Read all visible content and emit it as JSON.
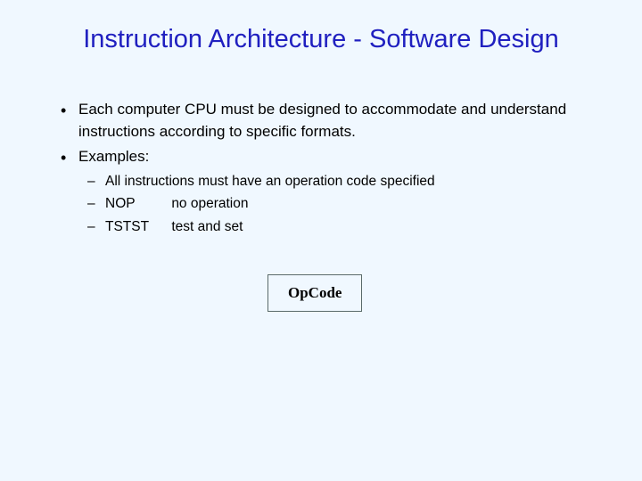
{
  "title": "Instruction Architecture - Software Design",
  "bullets": {
    "b1": "Each computer CPU must be designed to accommodate and understand instructions according to specific formats.",
    "b2": "Examples:",
    "sub1": "All instructions must have an operation code specified",
    "sub2_mnemonic": "NOP",
    "sub2_desc": "no operation",
    "sub3_mnemonic": "TSTST",
    "sub3_desc": "test and set"
  },
  "box": {
    "label": "OpCode"
  }
}
